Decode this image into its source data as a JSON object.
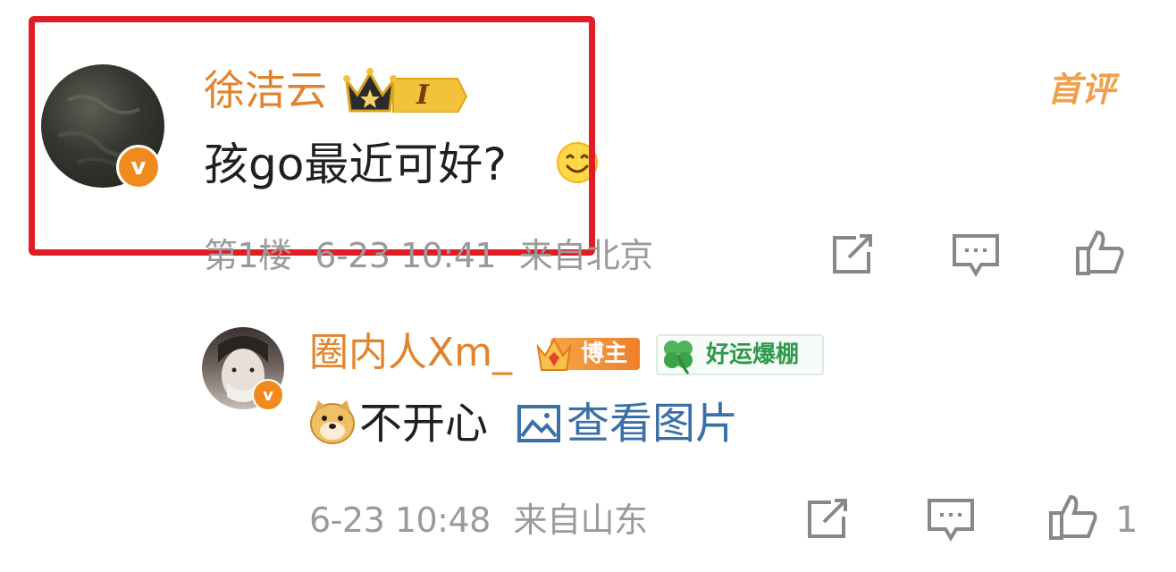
{
  "comment": {
    "username": "徐洁云",
    "level_badge": "I",
    "text": "孩go最近可好?",
    "first_comment_tag": "首评",
    "floor": "第1楼",
    "time": "6-23 10:41",
    "location": "来自北京",
    "icons": [
      "avatar",
      "verified-v-icon",
      "crown-level-icon",
      "smile-emoji-icon",
      "share-icon",
      "comment-icon",
      "like-icon"
    ]
  },
  "reply": {
    "username": "圈内人Xm_",
    "blogger_badge": "博主",
    "fortune_badge": "好运爆棚",
    "text": "不开心",
    "image_link": "查看图片",
    "time": "6-23 10:48",
    "location": "来自山东",
    "like_count": "1",
    "icons": [
      "avatar",
      "verified-v-icon",
      "crown-blogger-icon",
      "clover-icon",
      "doge-emoji-icon",
      "image-icon",
      "share-icon",
      "comment-icon",
      "like-icon"
    ]
  },
  "colors": {
    "username": "#e2832c",
    "highlight_border": "#e01c24",
    "link": "#3a6fa8",
    "meta": "#9a9a9a",
    "verified": "#f08a1f",
    "fortune_badge_text": "#2e9a4a"
  }
}
